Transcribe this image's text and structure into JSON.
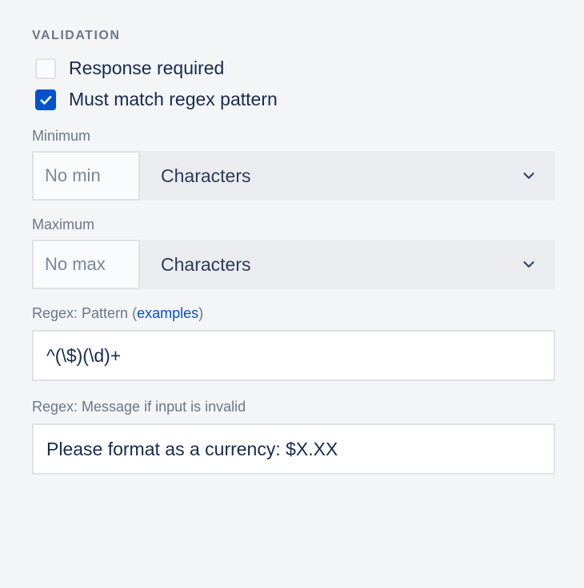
{
  "section": {
    "title": "VALIDATION"
  },
  "checkboxes": {
    "responseRequired": {
      "label": "Response required",
      "checked": false
    },
    "mustMatchRegex": {
      "label": "Must match regex pattern",
      "checked": true
    }
  },
  "minimum": {
    "label": "Minimum",
    "placeholder": "No min",
    "value": "",
    "unit": "Characters"
  },
  "maximum": {
    "label": "Maximum",
    "placeholder": "No max",
    "value": "",
    "unit": "Characters"
  },
  "regexPattern": {
    "labelPrefix": "Regex: Pattern (",
    "linkText": "examples",
    "labelSuffix": ")",
    "value": "^(\\$)(\\d)+"
  },
  "regexMessage": {
    "label": "Regex: Message if input is invalid",
    "value": "Please format as a currency: $X.XX"
  }
}
